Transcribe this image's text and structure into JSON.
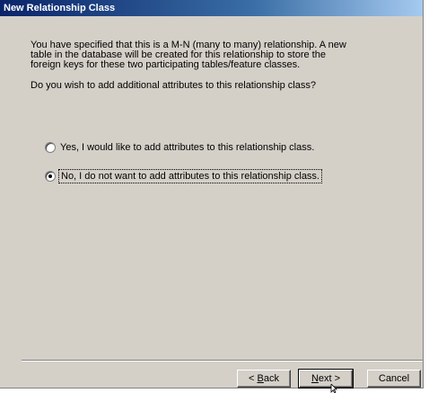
{
  "window": {
    "title": "New Relationship Class"
  },
  "content": {
    "intro_text": "You have specified that this is a M-N (many to many) relationship. A new table in the database will be created for this relationship to store the foreign keys for these two participating tables/feature classes.",
    "question": "Do you wish to add additional attributes to this relationship class?"
  },
  "options": [
    {
      "label": "Yes, I would like to add attributes to this relationship class.",
      "selected": false
    },
    {
      "label": "No, I do not want to add attributes to this relationship class.",
      "selected": true
    }
  ],
  "buttons": {
    "back": {
      "prefix": "< ",
      "mnemonic": "B",
      "rest": "ack"
    },
    "next": {
      "mnemonic": "N",
      "rest": "ext >"
    },
    "cancel": {
      "label": "Cancel"
    }
  },
  "colors": {
    "dialog_bg": "#d4d0c8",
    "titlebar_start": "#0a246a",
    "titlebar_end": "#a6caf0"
  }
}
